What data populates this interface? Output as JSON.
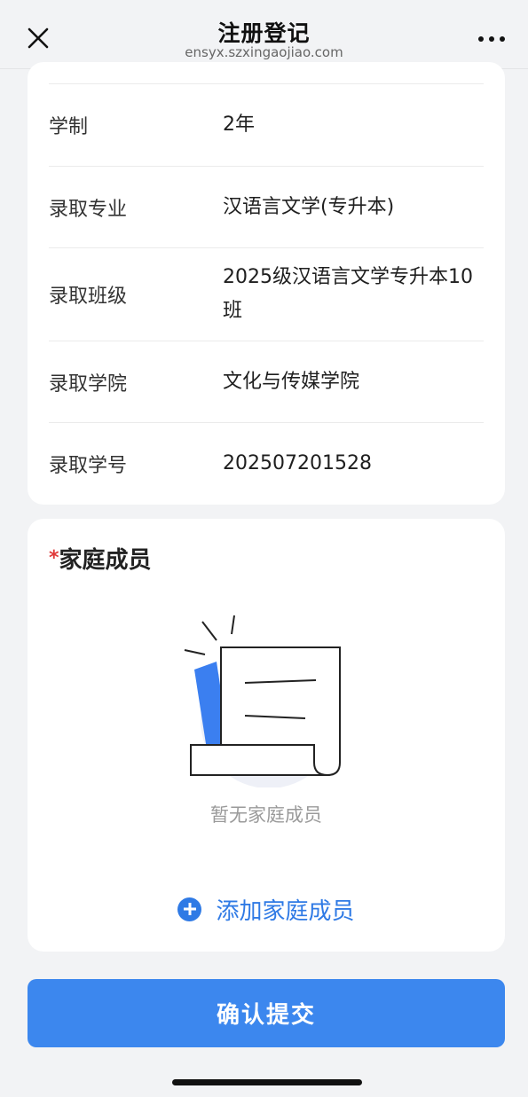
{
  "header": {
    "title": "注册登记",
    "url": "ensyx.szxingaojiao.com",
    "close_icon": "close-icon",
    "more_icon": "more-icon"
  },
  "info_rows": [
    {
      "label": "学制",
      "value": "2年"
    },
    {
      "label": "录取专业",
      "value": "汉语言文学(专升本)"
    },
    {
      "label": "录取班级",
      "value": "2025级汉语言文学专升本10班"
    },
    {
      "label": "录取学院",
      "value": "文化与传媒学院"
    },
    {
      "label": "录取学号",
      "value": "202507201528"
    }
  ],
  "family_section": {
    "required_mark": "*",
    "title": "家庭成员",
    "empty_text": "暂无家庭成员",
    "add_label": "添加家庭成员"
  },
  "submit_label": "确认提交",
  "colors": {
    "accent": "#3c87ee",
    "link": "#2f7ae5",
    "required": "#e03a3a",
    "background": "#f2f3f5"
  }
}
